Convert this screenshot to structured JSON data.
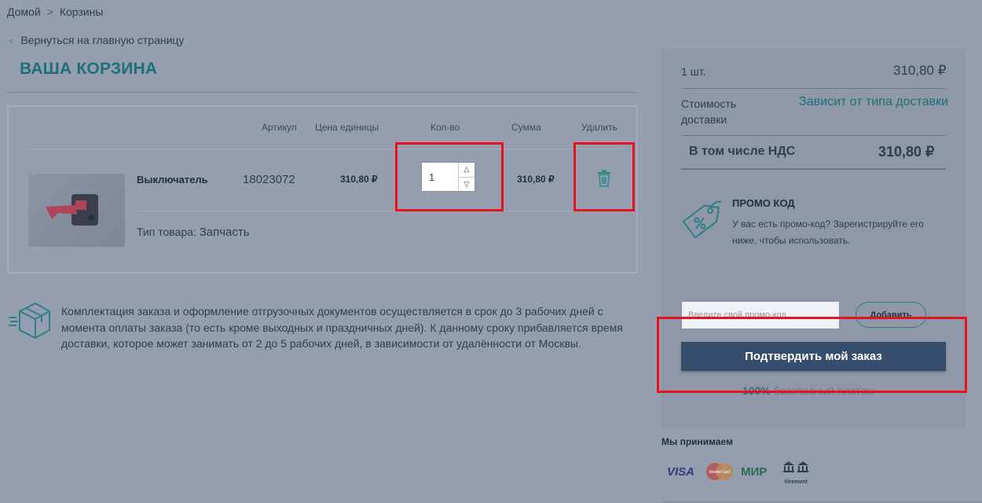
{
  "breadcrumb": {
    "home": "Домой",
    "separator": ">",
    "current": "Корзины"
  },
  "back_link": {
    "label": "Вернуться на главную страницу"
  },
  "page_title": "ВАША КОРЗИНА",
  "table": {
    "headers": {
      "sku": "Артикул",
      "unit_price": "Цена единицы",
      "qty": "Кол-во",
      "sum": "Сумма",
      "delete": "Удалить"
    }
  },
  "item": {
    "name": "Выключатель",
    "sku": "18023072",
    "unit_price": "310,80 ₽",
    "qty": "1",
    "sum": "310,80 ₽",
    "type_label": "Тип товара:",
    "type_value": "Запчасть"
  },
  "delivery_note": "Комплектация заказа и оформление отгрузочных документов осуществляется в срок до 3 рабочих дней с момента оплаты заказа (то есть кроме выходных и праздничных дней). К данному сроку прибавляется время доставки, которое может занимать от 2 до 5 рабочих дней, в зависимости от удалённости от Москвы.",
  "summary": {
    "qty_label": "1 шт.",
    "qty_price": "310,80 ₽",
    "shipping_label": "Стоимость доставки",
    "shipping_value": "Зависит от типа доставки",
    "vat_label": "В том числе  НДС",
    "vat_value": "310,80 ₽",
    "promo_title": "ПРОМО КОД",
    "promo_desc": "У вас есть промо-код? Зарегистрируйте его ниже, чтобы использовать.",
    "promo_placeholder": "Введите свой промо-код",
    "promo_add": "Добавить",
    "confirm": "Подтвердить мой заказ",
    "secure_percent": "100%",
    "secure_text": " безопасный платеж"
  },
  "payments": {
    "title": "Мы принимаем",
    "visa": "VISA",
    "mastercard": "MasterCard",
    "mir": "МИР",
    "virement": "Virement"
  },
  "colors": {
    "accent": "#1f6f78",
    "primary_button": "#364e6c",
    "highlight": "#e8111d",
    "overlay_bg": "#959eae"
  },
  "icons": [
    "chevron-left-icon",
    "trash-icon",
    "box-delivery-icon",
    "promo-tag-icon",
    "chevron-up-icon",
    "chevron-down-icon"
  ]
}
